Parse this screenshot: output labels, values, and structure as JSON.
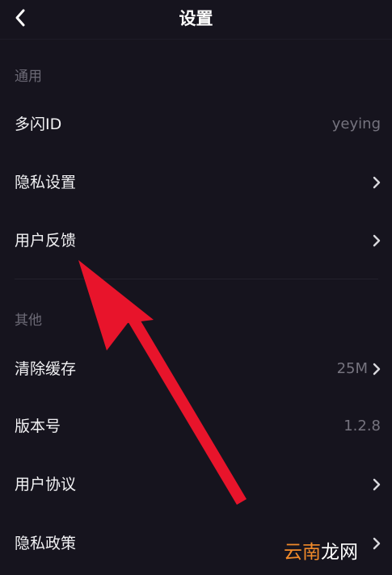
{
  "header": {
    "title": "设置",
    "back_icon": "chevron-left-icon"
  },
  "sections": {
    "general": {
      "label": "通用",
      "rows": [
        {
          "label": "多闪ID",
          "value": "yeying"
        },
        {
          "label": "隐私设置"
        },
        {
          "label": "用户反馈"
        }
      ]
    },
    "other": {
      "label": "其他",
      "rows": [
        {
          "label": "清除缓存",
          "value": "25M"
        },
        {
          "label": "版本号",
          "value": "1.2.8"
        },
        {
          "label": "用户协议"
        },
        {
          "label": "隐私政策"
        }
      ]
    }
  },
  "annotation": {
    "arrow_color": "#e8142b",
    "points_to": "用户反馈"
  },
  "watermark": {
    "accent": "云南",
    "rest": "龙网",
    "accent_color": "#f08a2a"
  },
  "colors": {
    "background": "#16141e",
    "text_primary": "#f2f2f4",
    "text_secondary": "#75737e",
    "section_label": "#6c6a76"
  }
}
